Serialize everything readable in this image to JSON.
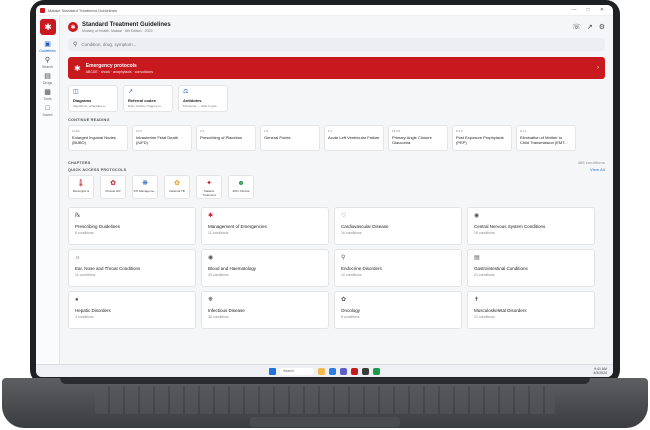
{
  "window": {
    "title": "Malawi Standard Treatment Guidelines"
  },
  "sidebar": {
    "items": [
      {
        "label": "Guidelines",
        "icon": "book-icon"
      },
      {
        "label": "Search",
        "icon": "search-icon"
      },
      {
        "label": "Drugs",
        "icon": "pill-icon"
      },
      {
        "label": "Tools",
        "icon": "calculator-icon"
      },
      {
        "label": "Saved",
        "icon": "bookmark-icon"
      }
    ]
  },
  "header": {
    "title": "Standard Treatment Guidelines",
    "subtitle": "Ministry of Health, Malawi · 6th Edition · 2023"
  },
  "search": {
    "placeholder": "Condition, drug, symptom..."
  },
  "emergency": {
    "title": "Emergency protocols",
    "subtitle": "ABCDE · shock · anaphylaxis · convulsions"
  },
  "tools": [
    {
      "title": "Diagrams",
      "subtitle": "Algorithms, schedules a..."
    },
    {
      "title": "Referral codes",
      "subtitle": "Entry criteria / triggers to ..."
    },
    {
      "title": "Antidotes",
      "subtitle": "Poisoning — what to give"
    }
  ],
  "continue_reading": {
    "label": "CONTINUE READING",
    "items": [
      {
        "code": "11.8A",
        "name": "Enlarged Inguinal Nodes (BUBO)"
      },
      {
        "code": "10.2",
        "name": "Intrauterine Fetal Death (IUFD)"
      },
      {
        "code": "2.3",
        "name": "Prescribing of Placebos"
      },
      {
        "code": "1.8",
        "name": "General Points"
      },
      {
        "code": "5.1",
        "name": "Acute Left Ventricular Failure"
      },
      {
        "code": "15.6.5",
        "name": "Primary Angle Closure Glaucoma"
      },
      {
        "code": "8.3.6",
        "name": "Post Exposure Prophylaxis (PEP)"
      },
      {
        "code": "9.1.1",
        "name": "Elimination of Mother to Child Transmission (EMT..."
      }
    ]
  },
  "chapters_header": {
    "label": "CHAPTERS",
    "count": "485 conditions"
  },
  "quick_access": {
    "label": "QUICK ACCESS PROTOCOLS",
    "link": "View All",
    "items": [
      {
        "label": "Meningitis & ",
        "icon": "thermometer-icon",
        "color": "#c8191e"
      },
      {
        "label": "Clinical HIV",
        "icon": "ribbon-icon",
        "color": "#c8191e"
      },
      {
        "label": "STI Manageme...",
        "icon": "virus-icon",
        "color": "#1f5fbf"
      },
      {
        "label": "National TB",
        "icon": "lungs-icon",
        "color": "#e89b1a"
      },
      {
        "label": "Malaria Treatment",
        "icon": "mosquito-icon",
        "color": "#c8191e"
      },
      {
        "label": "IMCI Clinical",
        "icon": "child-icon",
        "color": "#2a9d4b"
      }
    ]
  },
  "chapters": [
    {
      "name": "Prescribing Guidelines",
      "count": "8 conditions",
      "icon": "prescription-icon"
    },
    {
      "name": "Management of Emergencies",
      "count": "11 conditions",
      "icon": "emergency-icon"
    },
    {
      "name": "Cardiovascular Disease",
      "count": "16 conditions",
      "icon": "heart-icon"
    },
    {
      "name": "Central Nervous System Conditions",
      "count": "18 conditions",
      "icon": "brain-icon"
    },
    {
      "name": "Ear, Nose and Throat Conditions",
      "count": "11 conditions",
      "icon": "ear-icon"
    },
    {
      "name": "Blood and Haematology",
      "count": "20 conditions",
      "icon": "blood-drop-icon"
    },
    {
      "name": "Endocrine Disorders",
      "count": "10 conditions",
      "icon": "gland-icon"
    },
    {
      "name": "Gastrointestinal Conditions",
      "count": "21 conditions",
      "icon": "stomach-icon"
    },
    {
      "name": "Hepatic Disorders",
      "count": "3 conditions",
      "icon": "liver-icon"
    },
    {
      "name": "Infectious Disease",
      "count": "36 conditions",
      "icon": "germ-icon"
    },
    {
      "name": "Oncology",
      "count": "8 conditions",
      "icon": "ribbon-icon"
    },
    {
      "name": "Musculoskeletal Disorders",
      "count": "12 conditions",
      "icon": "bone-icon"
    }
  ],
  "taskbar": {
    "search_placeholder": "Search",
    "time": "9:41 AM",
    "date": "4/3/2024"
  },
  "colors": {
    "accent": "#c8191e",
    "link": "#1f5fbf"
  }
}
